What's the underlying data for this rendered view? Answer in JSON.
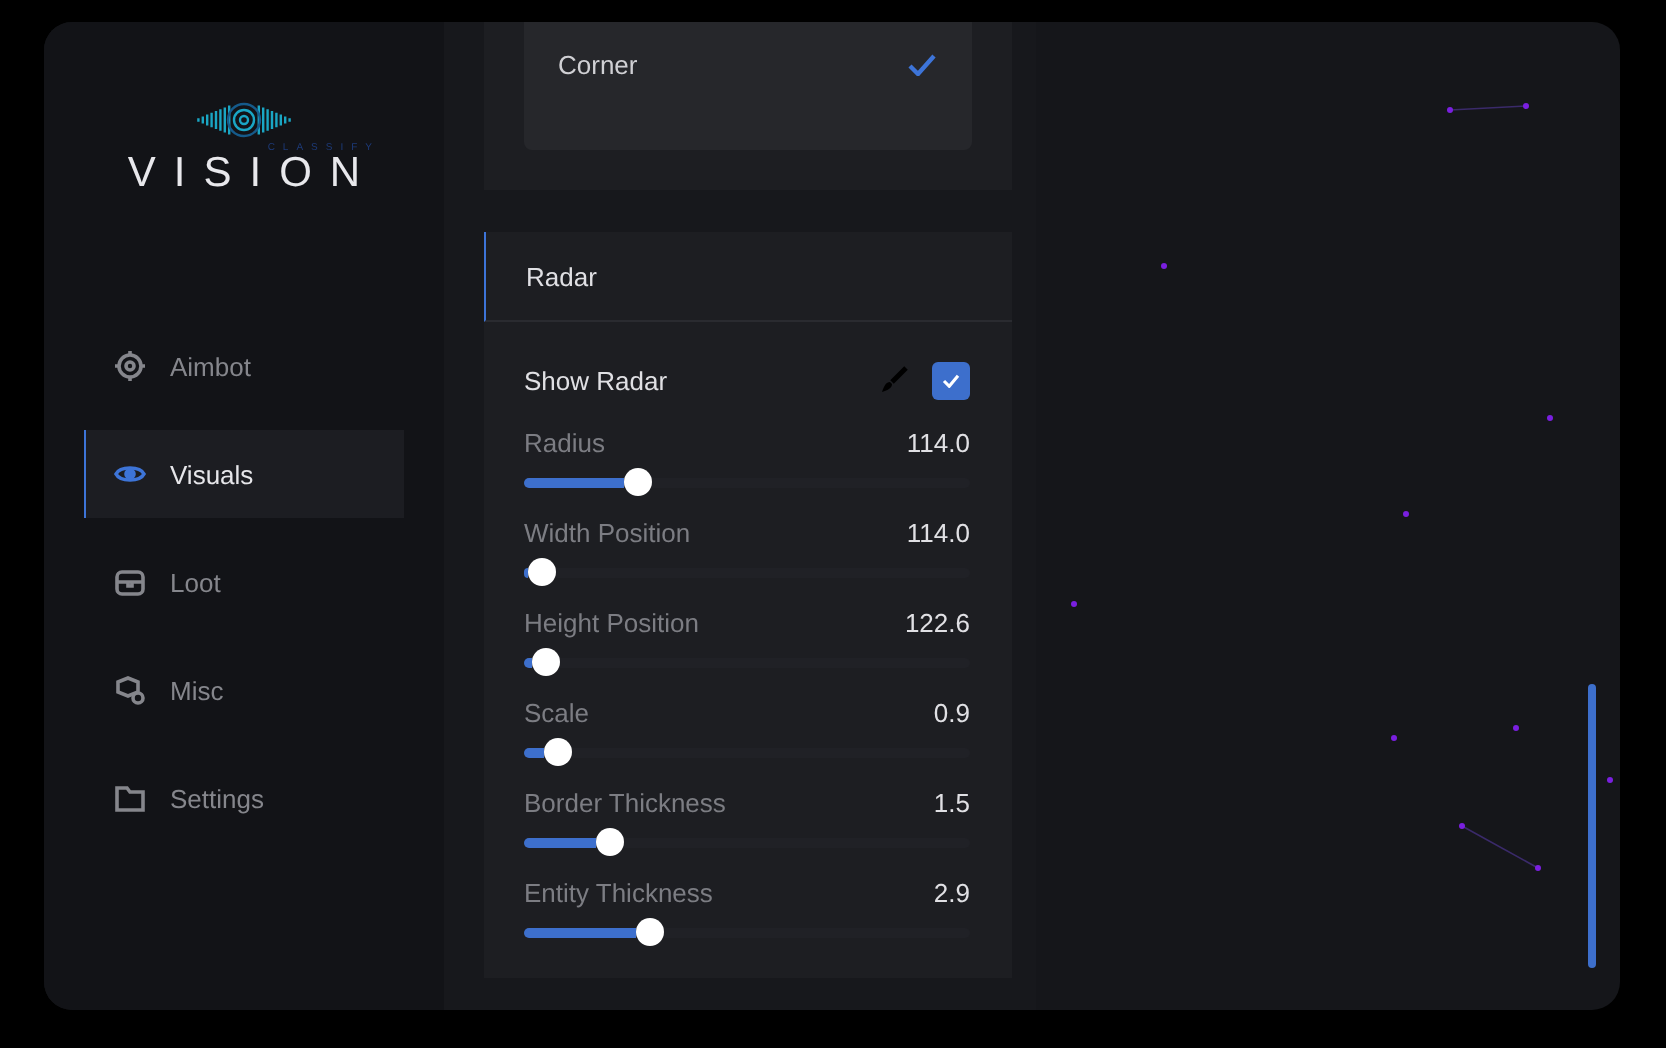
{
  "logo": {
    "tagline": "CLASSIFY",
    "name": "VISION"
  },
  "sidebar": {
    "items": [
      {
        "label": "Aimbot",
        "selected": false
      },
      {
        "label": "Visuals",
        "selected": true
      },
      {
        "label": "Loot",
        "selected": false
      },
      {
        "label": "Misc",
        "selected": false
      },
      {
        "label": "Settings",
        "selected": false
      }
    ]
  },
  "style_panel": {
    "options": [
      {
        "label": "Corner",
        "selected": true
      }
    ]
  },
  "radar_panel": {
    "title": "Radar",
    "toggle": {
      "label": "Show Radar",
      "checked": true
    },
    "sliders": [
      {
        "label": "Radius",
        "reading": "114.0",
        "level": 0.24
      },
      {
        "label": "Width Position",
        "reading": "114.0",
        "level": 0.01
      },
      {
        "label": "Height Position",
        "reading": "122.6",
        "level": 0.02
      },
      {
        "label": "Scale",
        "reading": "0.9",
        "level": 0.05
      },
      {
        "label": "Border Thickness",
        "reading": "1.5",
        "level": 0.17
      },
      {
        "label": "Entity Thickness",
        "reading": "2.9",
        "level": 0.27
      }
    ]
  }
}
